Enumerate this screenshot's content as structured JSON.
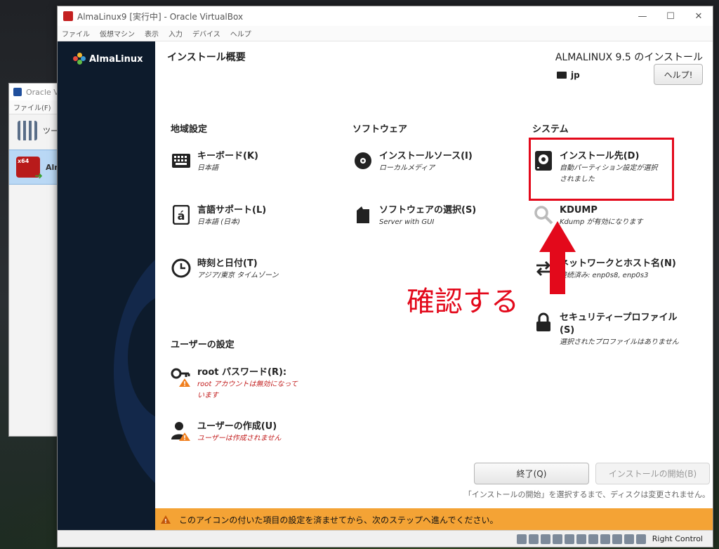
{
  "background_window": {
    "title": "Oracle VirtualBox",
    "title_visible": "Oracle V",
    "menu": "ファイル(F)",
    "tools_label": "ツー",
    "vm_name": "Alm",
    "vm_badge": "x64"
  },
  "vm_window": {
    "title": "AlmaLinux9 [実行中] - Oracle VirtualBox",
    "menus": [
      "ファイル",
      "仮想マシン",
      "表示",
      "入力",
      "デバイス",
      "ヘルプ"
    ],
    "controls": [
      "—",
      "☐",
      "✕"
    ]
  },
  "installer": {
    "brand": "AlmaLinux",
    "page_title": "インストール概要",
    "product_title": "ALMALINUX 9.5 のインストール",
    "keyboard_layout": "jp",
    "help_button": "ヘルプ!",
    "sections": {
      "localization": "地域設定",
      "software": "ソフトウェア",
      "system": "システム",
      "user": "ユーザーの設定"
    },
    "spokes": {
      "keyboard": {
        "title": "キーボード(K)",
        "status": "日本語"
      },
      "language": {
        "title": "言語サポート(L)",
        "status": "日本語 (日本)"
      },
      "time": {
        "title": "時刻と日付(T)",
        "status": "アジア/東京 タイムゾーン"
      },
      "source": {
        "title": "インストールソース(I)",
        "status": "ローカルメディア"
      },
      "software": {
        "title": "ソフトウェアの選択(S)",
        "status": "Server with GUI"
      },
      "destination": {
        "title": "インストール先(D)",
        "status_line1": "自動パーティション設定が選択",
        "status_line2": "されました"
      },
      "kdump": {
        "title": "KDUMP",
        "status": "Kdump が有効になります"
      },
      "network": {
        "title": "ネットワークとホスト名(N)",
        "status": "接続済み: enp0s8, enp0s3"
      },
      "security": {
        "title_line1": "セキュリティープロファイル",
        "title_line2": "(S)",
        "status": "選択されたプロファイルはありません"
      },
      "root": {
        "title": "root パスワード(R):",
        "status_line1": "root アカウントは無効になって",
        "status_line2": "います"
      },
      "user": {
        "title": "ユーザーの作成(U)",
        "status": "ユーザーは作成されません"
      }
    },
    "annotation": "確認する",
    "quit_button": "終了(Q)",
    "begin_button": "インストールの開始(B)",
    "footer_note": "「インストールの開始」を選択するまで、ディスクは変更されません。",
    "warning_text": "このアイコンの付いた項目の設定を済ませてから、次のステップへ進んでください。"
  },
  "statusbar": {
    "host_key": "Right Control"
  },
  "colors": {
    "sidebar": "#0d1b2c",
    "annotation_red": "#e3091b",
    "warning_bar": "#f4a335",
    "warn_text": "#c21d1d"
  }
}
